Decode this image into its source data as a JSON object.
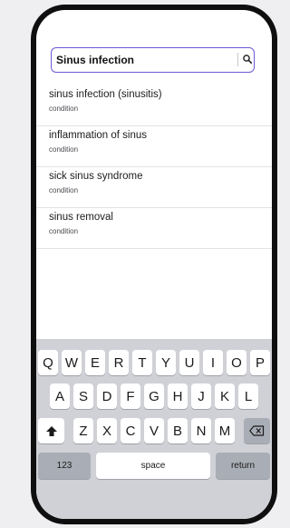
{
  "search": {
    "value": "Sinus infection"
  },
  "results": [
    {
      "title": "sinus infection (sinusitis)",
      "type": "condition"
    },
    {
      "title": "inflammation of sinus",
      "type": "condition"
    },
    {
      "title": "sick sinus syndrome",
      "type": "condition"
    },
    {
      "title": "sinus removal",
      "type": "condition"
    }
  ],
  "keyboard": {
    "row1": [
      "Q",
      "W",
      "E",
      "R",
      "T",
      "Y",
      "U",
      "I",
      "O",
      "P"
    ],
    "row2": [
      "A",
      "S",
      "D",
      "F",
      "G",
      "H",
      "J",
      "K",
      "L"
    ],
    "row3": [
      "Z",
      "X",
      "C",
      "V",
      "B",
      "N",
      "M"
    ],
    "numbers_label": "123",
    "space_label": "space",
    "return_label": "return"
  },
  "colors": {
    "accent": "#6b5bd6",
    "keyboard_bg": "#cfd1d6"
  }
}
